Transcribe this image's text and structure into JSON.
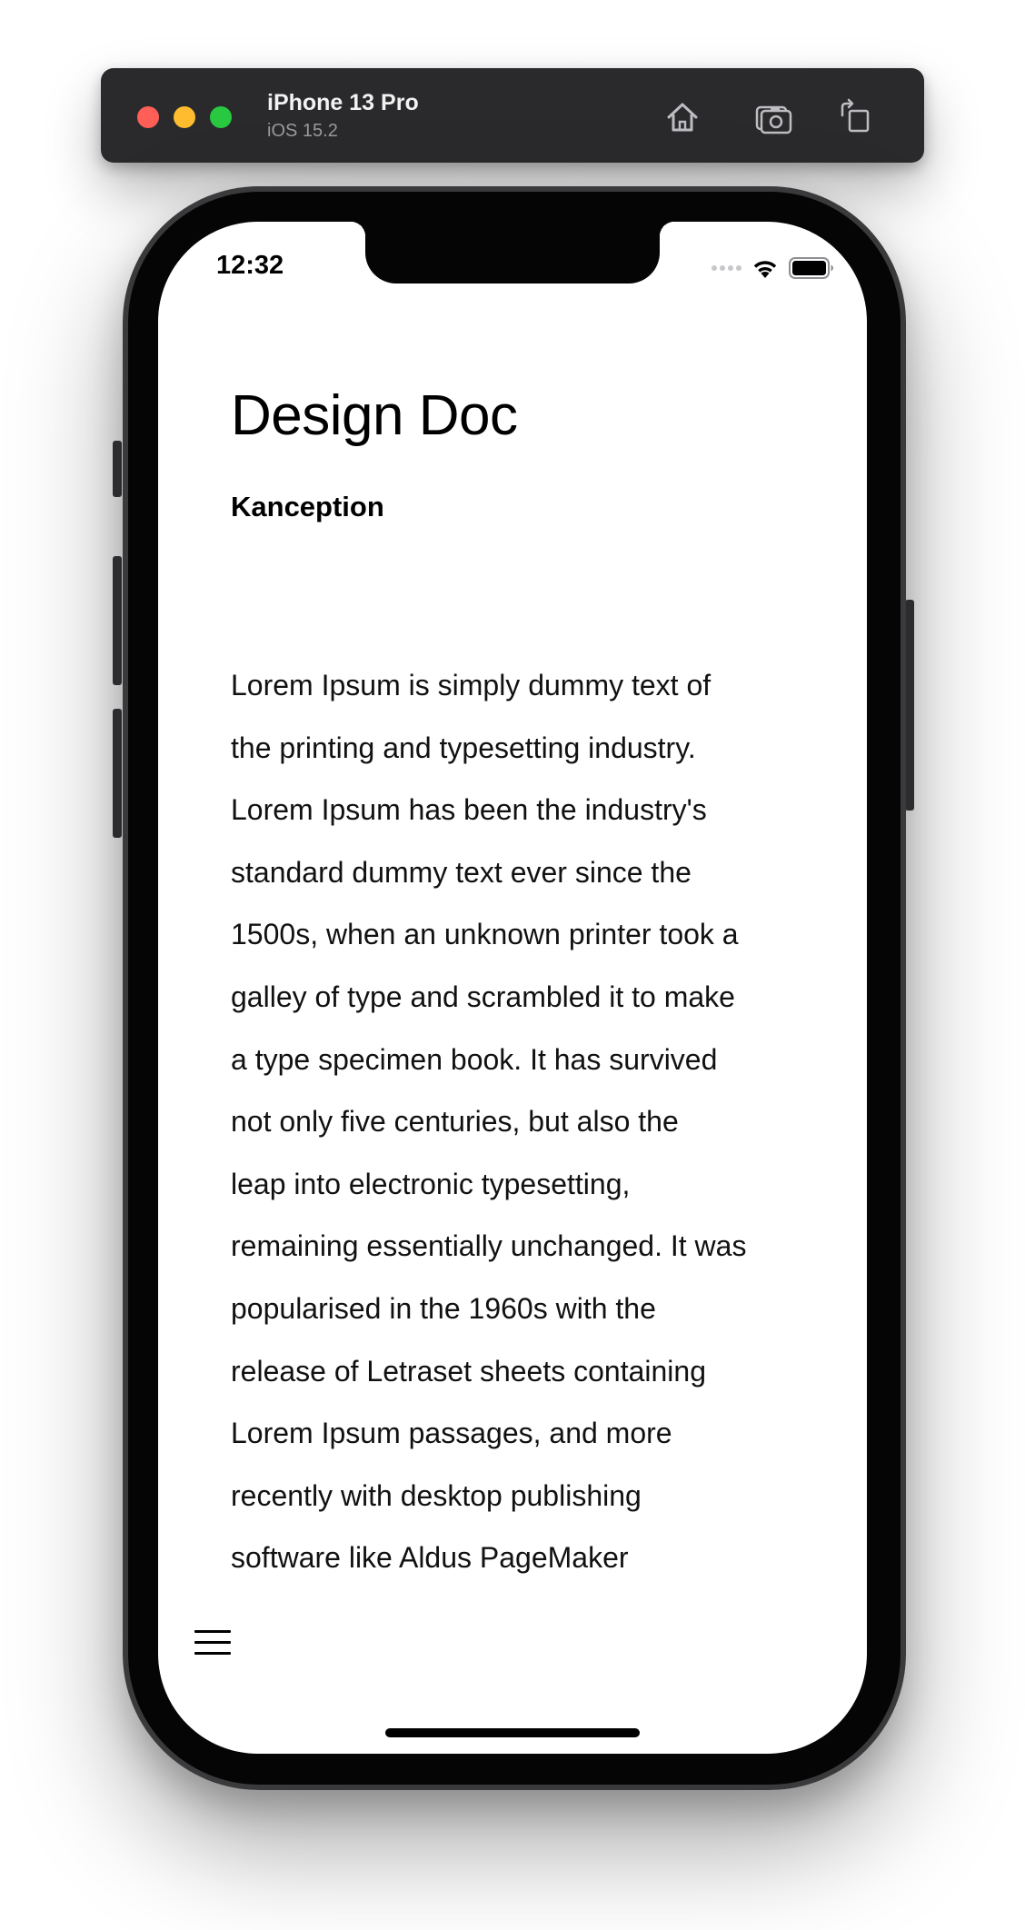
{
  "simulator": {
    "device_name": "iPhone 13 Pro",
    "os_version": "iOS 15.2",
    "icons": [
      "home-icon",
      "screenshot-icon",
      "rotate-icon"
    ]
  },
  "status_bar": {
    "time": "12:32",
    "icons": [
      "signal-icon",
      "wifi-icon",
      "battery-icon"
    ]
  },
  "document": {
    "title": "Design Doc",
    "subtitle": "Kanception",
    "body_lines": [
      "Lorem Ipsum is simply dummy text of",
      "the printing and typesetting industry.",
      "Lorem Ipsum has been the industry's",
      "standard dummy text ever since the",
      "1500s, when an unknown printer took a",
      "galley of type and scrambled it to make",
      "a type specimen book. It has survived",
      "not only five centuries, but also the",
      "leap into electronic typesetting,",
      "remaining essentially unchanged. It was",
      "popularised in the 1960s with the",
      "release of Letraset sheets containing",
      "Lorem Ipsum passages, and more",
      "recently with desktop publishing",
      "software like Aldus PageMaker"
    ]
  },
  "toolbar": {
    "menu_icon": "hamburger-menu-icon"
  }
}
